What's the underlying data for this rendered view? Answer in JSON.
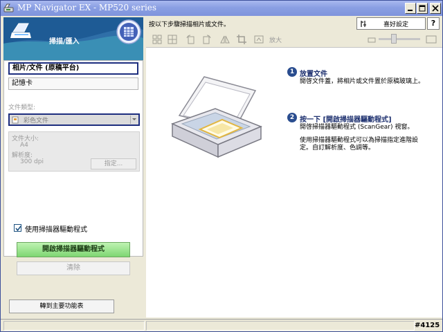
{
  "window": {
    "title": "MP Navigator EX - MP520 series"
  },
  "left_panel": {
    "mode_label": "掃描/匯入",
    "sources": [
      {
        "label": "相片/文件 (原稿平台)",
        "selected": true
      },
      {
        "label": "記憶卡",
        "selected": false
      }
    ],
    "document_type": {
      "label": "文件類型:",
      "value": "彩色文件"
    },
    "document_size": {
      "label": "文件大小:",
      "value": "A4"
    },
    "resolution": {
      "label": "解析度:",
      "value": "300 dpi"
    },
    "specify_label": "指定...",
    "use_driver": {
      "label": "使用掃描器驅動程式",
      "checked": true
    },
    "open_driver_label": "開啟掃描器驅動程式",
    "clear_label": "清除",
    "main_menu_label": "轉到主要功能表"
  },
  "top_bar": {
    "instruction": "按以下步驟掃描相片或文件。",
    "preferences_label": "喜好設定",
    "help_label": "?"
  },
  "toolbar": {
    "zoom_label": "放大"
  },
  "steps": [
    {
      "number": "1",
      "title": "放置文件",
      "desc": [
        "開啓文件蓋，將相片或文件置於原稿玻璃上。"
      ]
    },
    {
      "number": "2",
      "title": "按一下 [開啟掃描器驅動程式]",
      "desc": [
        "開啓掃描器驅動程式 (ScanGear) 視窗。",
        "",
        "使用掃描器驅動程式可以為掃描指定進階設",
        "定。自訂解析度、色調等。"
      ]
    }
  ],
  "watermark": "#4125",
  "colors": {
    "accent": "#2f6fa8",
    "title_bar": "#8a9fe3",
    "open_button": "#7ed672"
  }
}
